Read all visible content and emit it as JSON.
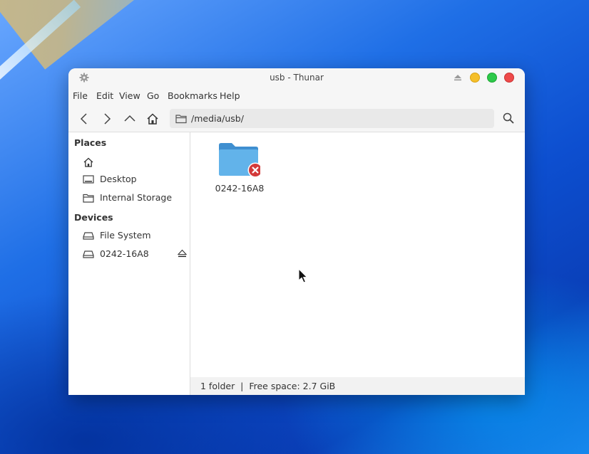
{
  "window": {
    "title": "usb - Thunar"
  },
  "menubar": {
    "items": [
      "File",
      "Edit",
      "View",
      "Go",
      "Bookmarks",
      "Help"
    ]
  },
  "toolbar": {
    "location_path": "/media/usb/"
  },
  "sidebar": {
    "places_heading": "Places",
    "places": [
      {
        "label": "",
        "icon": "home-icon"
      },
      {
        "label": "Desktop",
        "icon": "desktop-icon"
      },
      {
        "label": "Internal Storage",
        "icon": "folder-icon"
      }
    ],
    "devices_heading": "Devices",
    "devices": [
      {
        "label": "File System",
        "icon": "drive-icon"
      },
      {
        "label": "0242-16A8",
        "icon": "drive-icon",
        "ejectable": true
      }
    ]
  },
  "main": {
    "items": [
      {
        "name": "0242-16A8",
        "icon": "folder-icon",
        "emblem": "unreadable-emblem"
      }
    ]
  },
  "statusbar": {
    "text": "1 folder  |  Free space: 2.7 GiB"
  },
  "colors": {
    "folder": "#5aaee6",
    "emblem": "#d33a3a",
    "minimize": "#f5bf2a",
    "maximize": "#2dc94a",
    "close": "#ee4a4a"
  }
}
